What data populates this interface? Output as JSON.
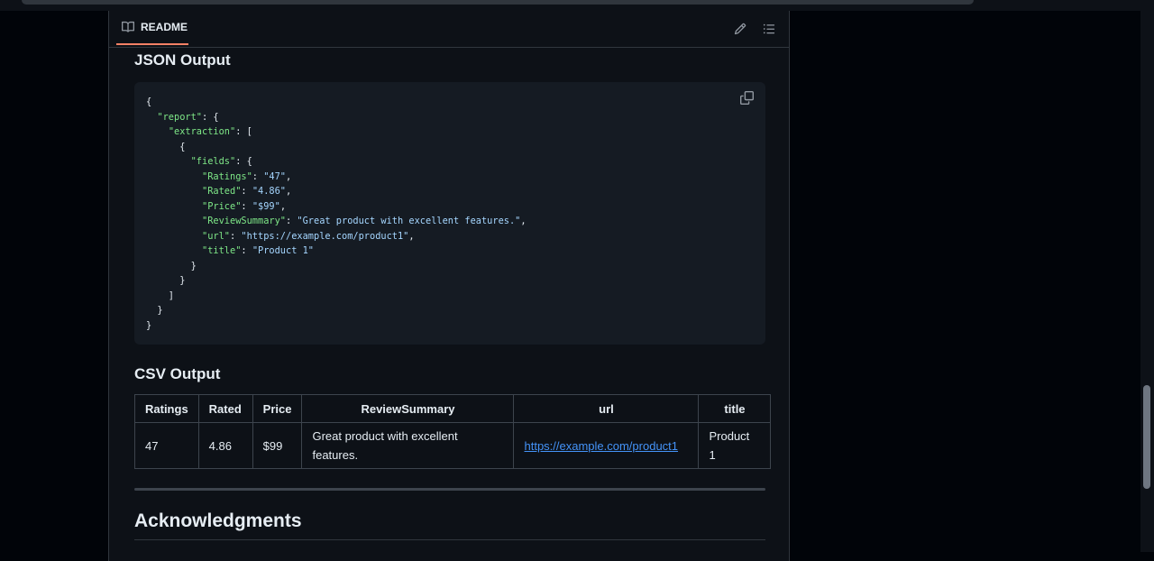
{
  "readme": {
    "tab_label": "README",
    "icons": {
      "book": "book-icon",
      "edit": "pencil-icon",
      "toc": "list-icon",
      "copy": "copy-icon"
    }
  },
  "json_section": {
    "heading": "JSON Output",
    "code_lines": [
      [
        {
          "t": "p",
          "v": "{"
        }
      ],
      [
        {
          "t": "p",
          "v": "  "
        },
        {
          "t": "k",
          "v": "\"report\""
        },
        {
          "t": "p",
          "v": ": {"
        }
      ],
      [
        {
          "t": "p",
          "v": "    "
        },
        {
          "t": "k",
          "v": "\"extraction\""
        },
        {
          "t": "p",
          "v": ": ["
        }
      ],
      [
        {
          "t": "p",
          "v": "      {"
        }
      ],
      [
        {
          "t": "p",
          "v": "        "
        },
        {
          "t": "k",
          "v": "\"fields\""
        },
        {
          "t": "p",
          "v": ": {"
        }
      ],
      [
        {
          "t": "p",
          "v": "          "
        },
        {
          "t": "k",
          "v": "\"Ratings\""
        },
        {
          "t": "p",
          "v": ": "
        },
        {
          "t": "s",
          "v": "\"47\""
        },
        {
          "t": "p",
          "v": ","
        }
      ],
      [
        {
          "t": "p",
          "v": "          "
        },
        {
          "t": "k",
          "v": "\"Rated\""
        },
        {
          "t": "p",
          "v": ": "
        },
        {
          "t": "s",
          "v": "\"4.86\""
        },
        {
          "t": "p",
          "v": ","
        }
      ],
      [
        {
          "t": "p",
          "v": "          "
        },
        {
          "t": "k",
          "v": "\"Price\""
        },
        {
          "t": "p",
          "v": ": "
        },
        {
          "t": "s",
          "v": "\"$99\""
        },
        {
          "t": "p",
          "v": ","
        }
      ],
      [
        {
          "t": "p",
          "v": "          "
        },
        {
          "t": "k",
          "v": "\"ReviewSummary\""
        },
        {
          "t": "p",
          "v": ": "
        },
        {
          "t": "s",
          "v": "\"Great product with excellent features.\""
        },
        {
          "t": "p",
          "v": ","
        }
      ],
      [
        {
          "t": "p",
          "v": "          "
        },
        {
          "t": "k",
          "v": "\"url\""
        },
        {
          "t": "p",
          "v": ": "
        },
        {
          "t": "s",
          "v": "\"https://example.com/product1\""
        },
        {
          "t": "p",
          "v": ","
        }
      ],
      [
        {
          "t": "p",
          "v": "          "
        },
        {
          "t": "k",
          "v": "\"title\""
        },
        {
          "t": "p",
          "v": ": "
        },
        {
          "t": "s",
          "v": "\"Product 1\""
        }
      ],
      [
        {
          "t": "p",
          "v": "        }"
        }
      ],
      [
        {
          "t": "p",
          "v": "      }"
        }
      ],
      [
        {
          "t": "p",
          "v": "    ]"
        }
      ],
      [
        {
          "t": "p",
          "v": "  }"
        }
      ],
      [
        {
          "t": "p",
          "v": "}"
        }
      ]
    ]
  },
  "csv_section": {
    "heading": "CSV Output",
    "headers": [
      "Ratings",
      "Rated",
      "Price",
      "ReviewSummary",
      "url",
      "title"
    ],
    "row": {
      "ratings": "47",
      "rated": "4.86",
      "price": "$99",
      "review_summary_line1": "Great product with excellent",
      "review_summary_line2": "features.",
      "url": "https://example.com/product1",
      "title_line1": "Product",
      "title_line2": "1"
    }
  },
  "acknowledgments": {
    "heading": "Acknowledgments"
  },
  "colors": {
    "background": "#0d1117",
    "code_bg": "#151b23",
    "json_key": "#7ee787",
    "json_string": "#a5d6ff",
    "link": "#4493f8",
    "tab_underline": "#f78166"
  }
}
